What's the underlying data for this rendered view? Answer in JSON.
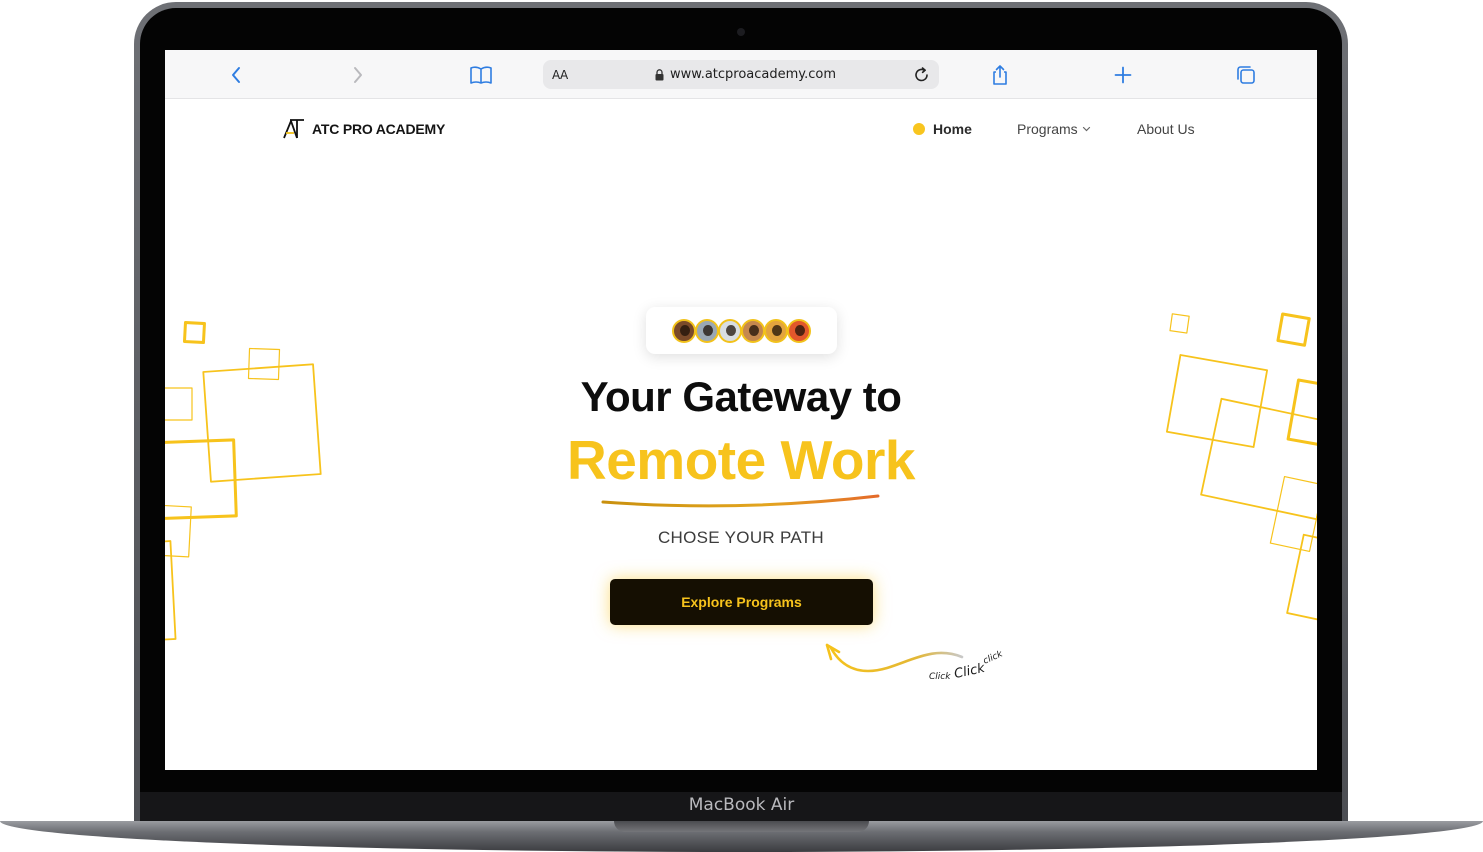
{
  "device": {
    "label": "MacBook Air"
  },
  "browser": {
    "text_size_label": "AA",
    "url": "www.atcproacademy.com",
    "icons": [
      "back-chevron-icon",
      "forward-chevron-icon",
      "bookmarks-book-icon",
      "lock-icon",
      "reload-icon",
      "share-icon",
      "new-tab-plus-icon",
      "tabs-overview-icon"
    ],
    "accent_color": "#2f7de1"
  },
  "site": {
    "brand": "ATC PRO ACADEMY",
    "nav": {
      "home": "Home",
      "programs": "Programs",
      "about": "About Us"
    },
    "hero": {
      "headline": "Your Gateway to",
      "highlight": "Remote Work",
      "tagline": "CHOSE YOUR PATH",
      "cta": "Explore Programs",
      "avatar_count": 6
    },
    "annotation": {
      "small_1": "Click",
      "large": "Click",
      "small_2": "click"
    },
    "colors": {
      "accent": "#f7c31c",
      "dark": "#150f02"
    }
  }
}
